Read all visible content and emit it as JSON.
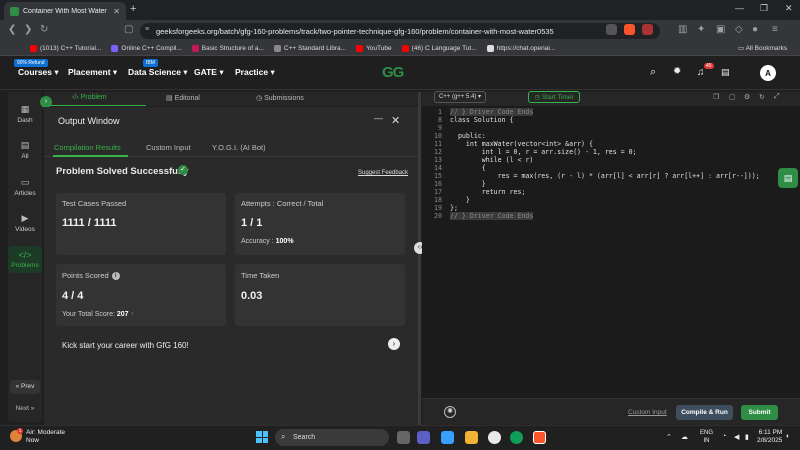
{
  "browser": {
    "tab_title": "Container With Most Water | P",
    "url": "geeksforgeeks.org/batch/gfg-160-problems/track/two-pointer-technique-gfg-160/problem/container-with-most-water0535",
    "bookmarks": [
      {
        "label": "(1013) C++ Tutorial...",
        "color": "#ff0000"
      },
      {
        "label": "Online C++ Compil...",
        "color": "#7b61ff"
      },
      {
        "label": "Basic Structure of a...",
        "color": "#c2185b"
      },
      {
        "label": "C++ Standard Libra...",
        "color": "#888888"
      },
      {
        "label": "YouTube",
        "color": "#ff0000"
      },
      {
        "label": "(46) C Language Tut...",
        "color": "#ff0000"
      },
      {
        "label": "https://chat.openai...",
        "color": "#dddddd"
      }
    ],
    "all_bookmarks": "All Bookmarks"
  },
  "header": {
    "refund_badge": "90% Refund",
    "ibm_badge": "IBM",
    "menu": [
      "Courses",
      "Placement",
      "Data Science",
      "GATE",
      "Practice"
    ],
    "logo": "GG",
    "notification_count": "45",
    "avatar": "A"
  },
  "sidebar": {
    "items": [
      {
        "label": "Dash",
        "icon": "▦"
      },
      {
        "label": "All",
        "icon": "▤"
      },
      {
        "label": "Articles",
        "icon": "▭"
      },
      {
        "label": "Videos",
        "icon": "▶"
      },
      {
        "label": "Problems",
        "icon": "</>"
      }
    ],
    "prev": "Prev",
    "next": "Next"
  },
  "problem_tabs": [
    "Problem",
    "Editorial",
    "Submissions"
  ],
  "output": {
    "title": "Output Window",
    "tabs": [
      "Compilation Results",
      "Custom Input",
      "Y.O.G.I. (AI Bot)"
    ],
    "status": "Problem Solved Successfully",
    "feedback": "Suggest Feedback",
    "test_cases_label": "Test Cases Passed",
    "test_cases_value": "1111 / 1111",
    "attempts_label": "Attempts : Correct / Total",
    "attempts_value": "1 / 1",
    "accuracy_label": "Accuracy :",
    "accuracy_value": "100%",
    "points_label": "Points Scored",
    "points_value": "4 / 4",
    "total_score_label": "Your Total Score:",
    "total_score_value": "207",
    "time_label": "Time Taken",
    "time_value": "0.03",
    "kickstart": "Kick start your career with GfG 160!"
  },
  "editor": {
    "language": "C++ (g++ 5.4)",
    "timer": "Start Timer",
    "lines": [
      {
        "n": "1",
        "text": "// } Driver Code Ends",
        "comment": true
      },
      {
        "n": "8",
        "text": "class Solution {",
        "comment": false
      },
      {
        "n": "9",
        "text": "",
        "comment": false
      },
      {
        "n": "10",
        "text": "  public:",
        "comment": false
      },
      {
        "n": "11",
        "text": "    int maxWater(vector<int> &arr) {",
        "comment": false
      },
      {
        "n": "12",
        "text": "        int l = 0, r = arr.size() - 1, res = 0;",
        "comment": false
      },
      {
        "n": "13",
        "text": "        while (l < r)",
        "comment": false
      },
      {
        "n": "14",
        "text": "        {",
        "comment": false
      },
      {
        "n": "15",
        "text": "            res = max(res, (r - l) * (arr[l] < arr[r] ? arr[l++] : arr[r--]));",
        "comment": false
      },
      {
        "n": "16",
        "text": "        }",
        "comment": false
      },
      {
        "n": "17",
        "text": "        return res;",
        "comment": false
      },
      {
        "n": "18",
        "text": "    }",
        "comment": false
      },
      {
        "n": "19",
        "text": "};",
        "comment": false
      },
      {
        "n": "20",
        "text": "// } Driver Code Ends",
        "comment": true
      }
    ],
    "custom_input": "Custom Input",
    "compile_run": "Compile & Run",
    "submit": "Submit"
  },
  "taskbar": {
    "weather_line1": "Air: Moderate",
    "weather_line2": "Now",
    "weather_badge": "1",
    "search": "Search",
    "lang_line1": "ENG",
    "lang_line2": "IN",
    "time": "6:11 PM",
    "date": "2/8/2025"
  }
}
